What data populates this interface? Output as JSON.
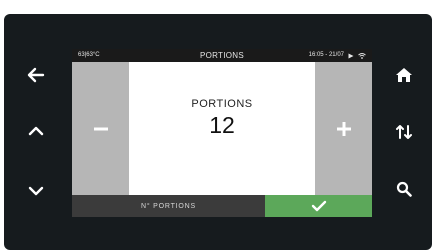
{
  "status_bar": {
    "temperature": "63|63°C",
    "title": "PORTIONS",
    "datetime": "16:05 - 21/07"
  },
  "panel": {
    "label": "PORTIONS",
    "value": "12"
  },
  "footer": {
    "label": "N° PORTIONS"
  },
  "colors": {
    "bezel": "#161b1e",
    "status_bar": "#1a1a1a",
    "stepper_panel": "#b6b6b6",
    "footer_label_bg": "#3b3b3b",
    "confirm": "#5ca85a"
  },
  "icons": {
    "left_buttons": [
      "arrow-left-icon",
      "chevron-up-icon",
      "chevron-down-icon"
    ],
    "right_buttons": [
      "home-icon",
      "sort-arrows-icon",
      "search-icon"
    ],
    "status": [
      "play-icon",
      "wifi-icon"
    ],
    "screen": [
      "minus-icon",
      "plus-icon",
      "checkmark-icon"
    ]
  }
}
